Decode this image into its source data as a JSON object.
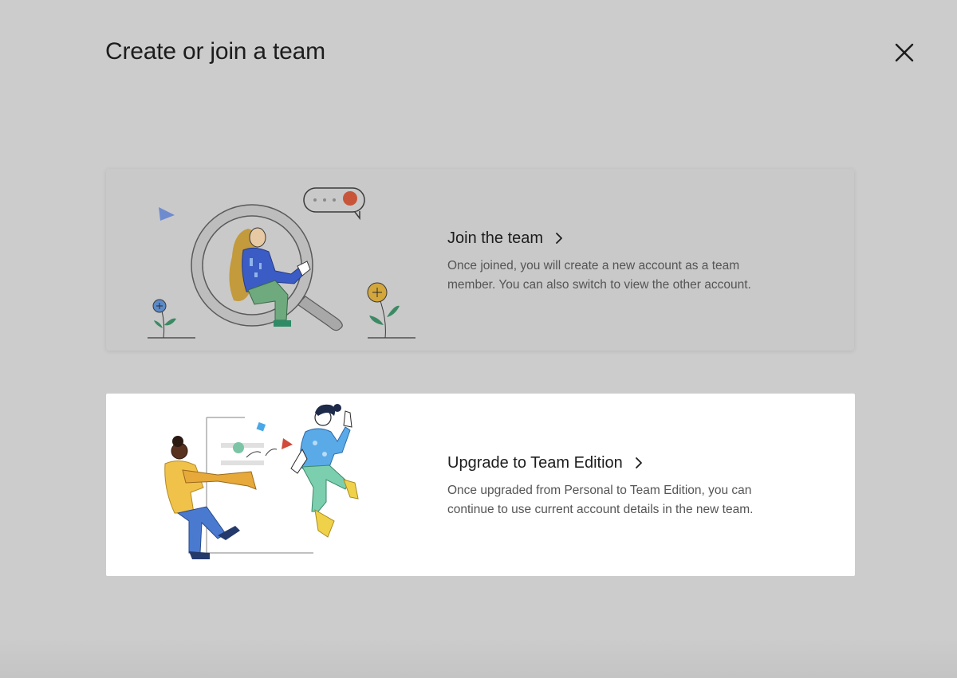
{
  "dialog": {
    "title": "Create or join a team",
    "close_icon": "close-icon"
  },
  "options": [
    {
      "heading": "Join the team",
      "description_line1": "Once joined, you will create a new account as a team",
      "description_line2": "member. You can also switch to view the other account.",
      "icon": "chevron-right-icon",
      "illustration": "magnifier-person-illustration"
    },
    {
      "heading": "Upgrade to Team Edition",
      "description_line1": "Once upgraded from Personal to Team Edition, you can",
      "description_line2": "continue to use current account details in the new team.",
      "icon": "chevron-right-icon",
      "illustration": "celebration-illustration"
    }
  ],
  "colors": {
    "overlay": "#cccccc",
    "card_hover": "#c9c9c9",
    "card": "#ffffff",
    "heading": "#1d1d1d",
    "description": "#555555"
  }
}
